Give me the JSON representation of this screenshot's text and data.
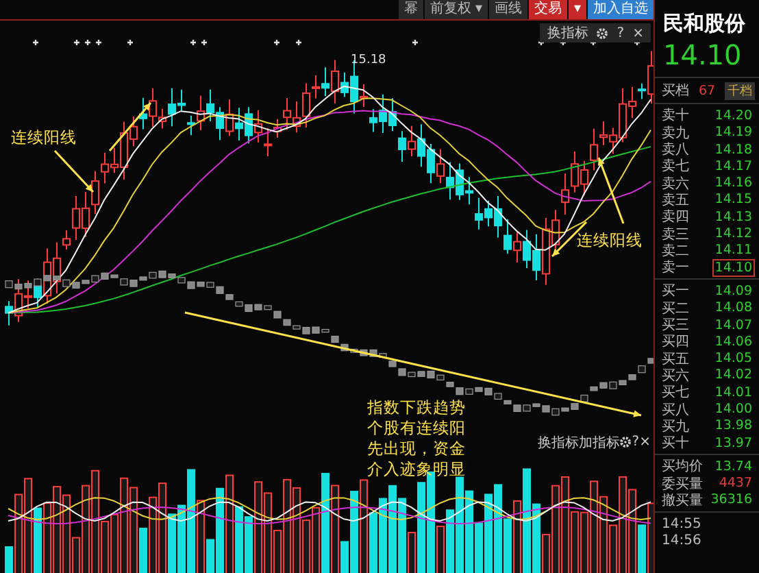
{
  "toolbar": {
    "buttons": [
      {
        "label": "幂",
        "kind": "plain"
      },
      {
        "label": "前复权 ▾",
        "kind": "plain"
      },
      {
        "label": "画线",
        "kind": "plain"
      },
      {
        "label": "交易",
        "kind": "trade"
      },
      {
        "label": "▾",
        "kind": "trade"
      },
      {
        "label": "加入自选",
        "kind": "add"
      }
    ]
  },
  "main_indicator_bar": {
    "buttons": [
      "换指标"
    ],
    "help": "?",
    "close": "×"
  },
  "chart": {
    "high_label": "15.18",
    "notes": [
      {
        "lines": [
          "连续阳线"
        ]
      },
      {
        "lines": [
          "连续阳线"
        ]
      },
      {
        "lines": [
          "指数下跌趋势",
          "个股有连续阳",
          "先出现，资金",
          "介入迹象明显"
        ]
      }
    ]
  },
  "volume_indicator_bar": {
    "buttons": [
      "换指标",
      "加指标"
    ],
    "help": "?",
    "close": "×"
  },
  "stock": {
    "name": "民和股份",
    "price": "14.10"
  },
  "order_book": {
    "header": {
      "label": "买档",
      "count": "67",
      "button": "千档"
    },
    "asks": [
      {
        "label": "卖十",
        "price": "14.20",
        "selected": false
      },
      {
        "label": "卖九",
        "price": "14.19",
        "selected": false
      },
      {
        "label": "卖八",
        "price": "14.18",
        "selected": false
      },
      {
        "label": "卖七",
        "price": "14.17",
        "selected": false
      },
      {
        "label": "卖六",
        "price": "14.16",
        "selected": false
      },
      {
        "label": "卖五",
        "price": "14.15",
        "selected": false
      },
      {
        "label": "卖四",
        "price": "14.13",
        "selected": false
      },
      {
        "label": "卖三",
        "price": "14.12",
        "selected": false
      },
      {
        "label": "卖二",
        "price": "14.11",
        "selected": false
      },
      {
        "label": "卖一",
        "price": "14.10",
        "selected": true
      }
    ],
    "bids": [
      {
        "label": "买一",
        "price": "14.09",
        "selected": false
      },
      {
        "label": "买二",
        "price": "14.08",
        "selected": false
      },
      {
        "label": "买三",
        "price": "14.07",
        "selected": false
      },
      {
        "label": "买四",
        "price": "14.06",
        "selected": false
      },
      {
        "label": "买五",
        "price": "14.05",
        "selected": false
      },
      {
        "label": "买六",
        "price": "14.02",
        "selected": false
      },
      {
        "label": "买七",
        "price": "14.01",
        "selected": false
      },
      {
        "label": "买八",
        "price": "14.00",
        "selected": false
      },
      {
        "label": "买九",
        "price": "13.98",
        "selected": false
      },
      {
        "label": "买十",
        "price": "13.97",
        "selected": false
      }
    ]
  },
  "stats": [
    {
      "label": "买均价",
      "value": "13.74",
      "color": "#2ed12e"
    },
    {
      "label": "委买量",
      "value": "4437",
      "color": "#e83a3a"
    },
    {
      "label": "撤买量",
      "value": "36316",
      "color": "#2ed12e"
    }
  ],
  "ticks": [
    {
      "time": "14:55"
    },
    {
      "time": "14:56"
    }
  ]
}
